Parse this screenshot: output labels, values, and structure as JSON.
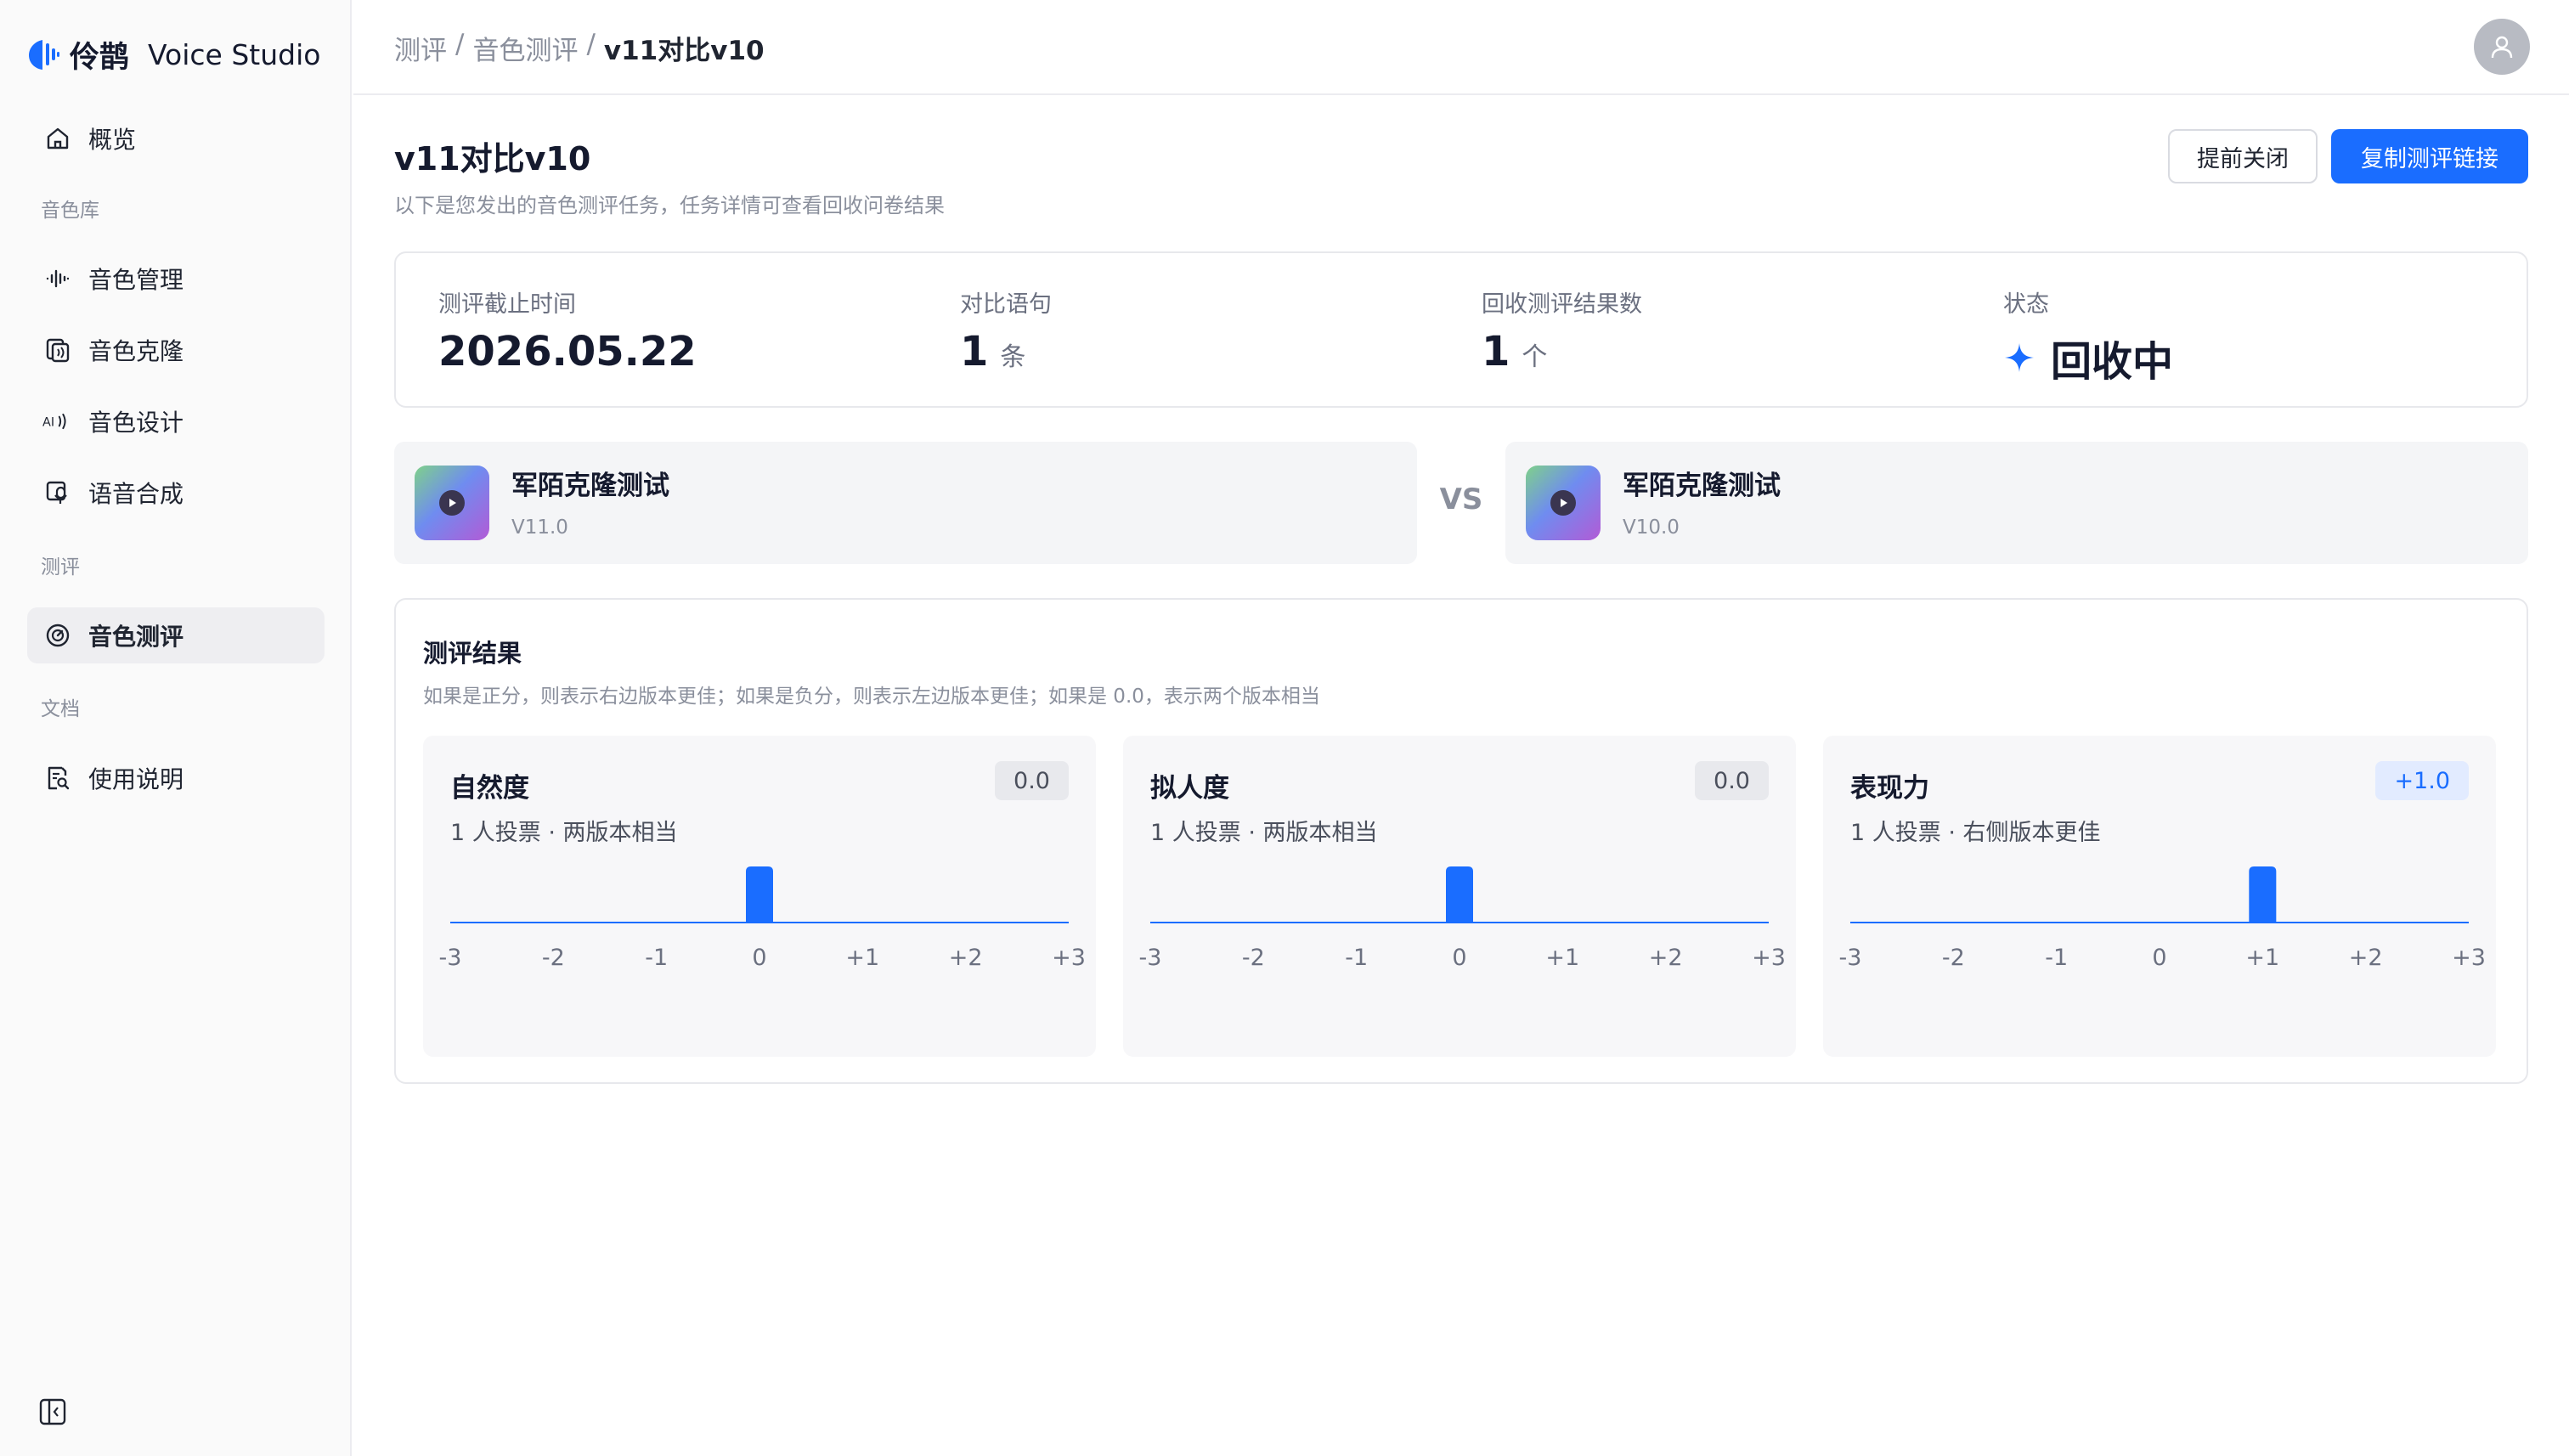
{
  "brand": {
    "name_cn": "伶鹊",
    "name_en": "Voice Studio"
  },
  "sidebar": {
    "overview": "概览",
    "section_voice": "音色库",
    "voice_manage": "音色管理",
    "voice_clone": "音色克隆",
    "voice_design": "音色设计",
    "speech_synth": "语音合成",
    "section_eval": "测评",
    "voice_eval": "音色测评",
    "section_docs": "文档",
    "usage_guide": "使用说明"
  },
  "breadcrumb": {
    "level1": "测评",
    "sep1": "/",
    "level2": "音色测评",
    "sep2": "/",
    "current": "v11对比v10"
  },
  "page": {
    "title": "v11对比v10",
    "subtitle": "以下是您发出的音色测评任务，任务详情可查看回收问卷结果",
    "close_early_label": "提前关闭",
    "copy_link_label": "复制测评链接"
  },
  "stats": {
    "deadline_label": "测评截止时间",
    "deadline_value": "2026.05.22",
    "sentences_label": "对比语句",
    "sentences_value": "1",
    "sentences_unit": "条",
    "results_label": "回收测评结果数",
    "results_value": "1",
    "results_unit": "个",
    "status_label": "状态",
    "status_value": "回收中",
    "status_color": "#1a6dff"
  },
  "compare": {
    "left": {
      "name": "军陌克隆测试",
      "version": "V11.0"
    },
    "vs": "VS",
    "right": {
      "name": "军陌克隆测试",
      "version": "V10.0"
    }
  },
  "results": {
    "title": "测评结果",
    "description": "如果是正分，则表示右边版本更佳；如果是负分，则表示左边版本更佳；如果是 0.0，表示两个版本相当",
    "metrics": [
      {
        "name": "自然度",
        "score_label": "0.0",
        "votes_text": "1 人投票 · 两版本相当"
      },
      {
        "name": "拟人度",
        "score_label": "0.0",
        "votes_text": "1 人投票 · 两版本相当"
      },
      {
        "name": "表现力",
        "score_label": "+1.0",
        "votes_text": "1 人投票 · 右侧版本更佳"
      }
    ]
  },
  "chart_data": [
    {
      "type": "bar",
      "title": "自然度",
      "categories": [
        "-3",
        "-2",
        "-1",
        "0",
        "+1",
        "+2",
        "+3"
      ],
      "values": [
        0,
        0,
        0,
        1,
        0,
        0,
        0
      ],
      "color": "#1a6dff"
    },
    {
      "type": "bar",
      "title": "拟人度",
      "categories": [
        "-3",
        "-2",
        "-1",
        "0",
        "+1",
        "+2",
        "+3"
      ],
      "values": [
        0,
        0,
        0,
        1,
        0,
        0,
        0
      ],
      "color": "#1a6dff"
    },
    {
      "type": "bar",
      "title": "表现力",
      "categories": [
        "-3",
        "-2",
        "-1",
        "0",
        "+1",
        "+2",
        "+3"
      ],
      "values": [
        0,
        0,
        0,
        0,
        1,
        0,
        0
      ],
      "color": "#1a6dff"
    }
  ],
  "colors": {
    "accent": "#1a6dff",
    "active_nav_bg": "#eeeef1"
  }
}
